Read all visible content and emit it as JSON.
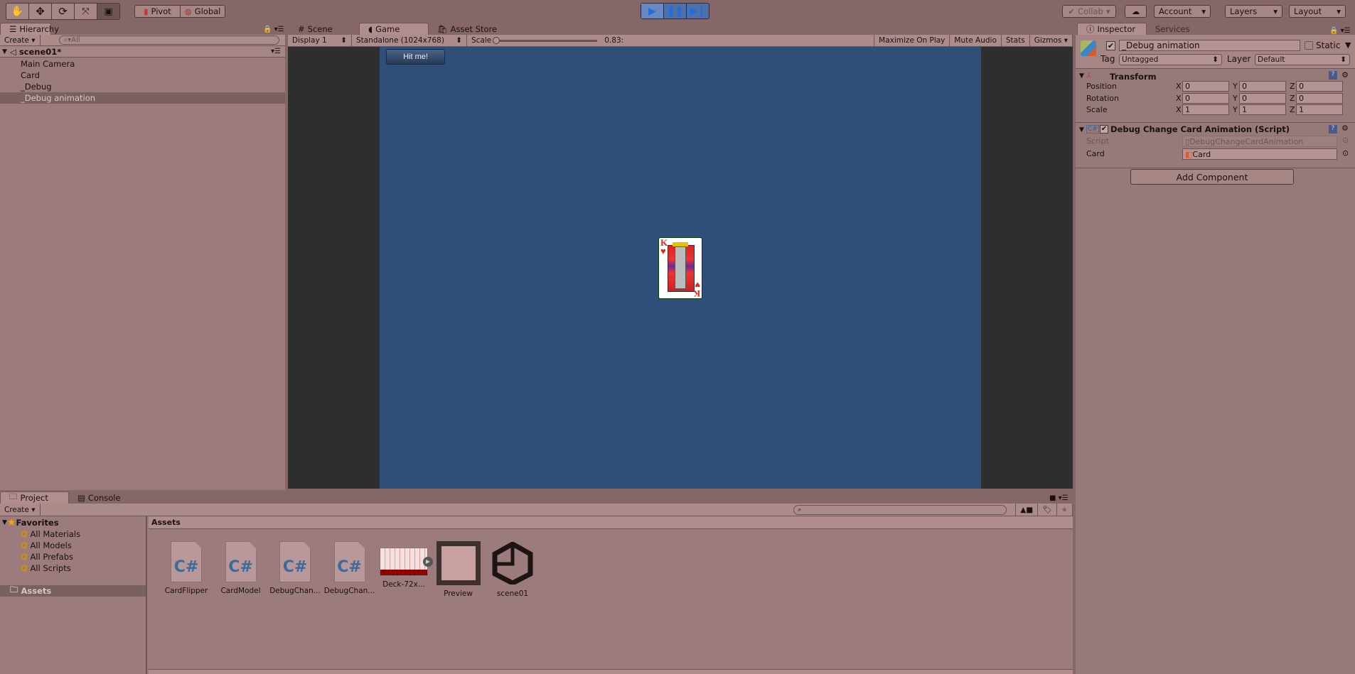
{
  "toolbar": {
    "tools": [
      "hand-icon",
      "move-icon",
      "rotate-icon",
      "scale-icon",
      "rect-icon"
    ],
    "pivot": "Pivot",
    "global": "Global",
    "collab": "Collab",
    "account": "Account",
    "layers": "Layers",
    "layout": "Layout"
  },
  "hierarchy": {
    "tab": "Hierarchy",
    "create": "Create",
    "search_placeholder": "All",
    "scene": "scene01*",
    "items": [
      "Main Camera",
      "Card",
      "_Debug",
      "_Debug animation"
    ],
    "selected": "_Debug animation"
  },
  "game": {
    "tabs": [
      "Scene",
      "Game",
      "Asset Store"
    ],
    "active_tab": "Game",
    "display": "Display 1",
    "resolution": "Standalone (1024x768)",
    "scale_label": "Scale",
    "scale_value": "0.83:",
    "maximize": "Maximize On Play",
    "mute": "Mute Audio",
    "stats": "Stats",
    "gizmos": "Gizmos",
    "hit_button": "Hit me!",
    "background": "#2f4e78"
  },
  "inspector": {
    "tabs": [
      "Inspector",
      "Services"
    ],
    "object_name": "_Debug animation",
    "active": true,
    "static_label": "Static",
    "tag_label": "Tag",
    "tag": "Untagged",
    "layer_label": "Layer",
    "layer": "Default",
    "transform": {
      "title": "Transform",
      "rows": [
        {
          "label": "Position",
          "x": "0",
          "y": "0",
          "z": "0"
        },
        {
          "label": "Rotation",
          "x": "0",
          "y": "0",
          "z": "0"
        },
        {
          "label": "Scale",
          "x": "1",
          "y": "1",
          "z": "1"
        }
      ]
    },
    "script": {
      "title": "Debug Change Card Animation (Script)",
      "script_label": "Script",
      "script_value": "DebugChangeCardAnimation",
      "card_label": "Card",
      "card_value": "Card"
    },
    "add_component": "Add Component"
  },
  "project": {
    "tabs": [
      "Project",
      "Console"
    ],
    "create": "Create",
    "favorites": "Favorites",
    "fav_items": [
      "All Materials",
      "All Models",
      "All Prefabs",
      "All Scripts"
    ],
    "assets_folder": "Assets",
    "breadcrumb": "Assets",
    "assets": [
      {
        "name": "CardFlipper",
        "type": "csharp"
      },
      {
        "name": "CardModel",
        "type": "csharp"
      },
      {
        "name": "DebugChan...",
        "type": "csharp"
      },
      {
        "name": "DebugChan...",
        "type": "csharp"
      },
      {
        "name": "Deck-72x...",
        "type": "sprite"
      },
      {
        "name": "Preview",
        "type": "material"
      },
      {
        "name": "scene01",
        "type": "scene"
      }
    ]
  }
}
